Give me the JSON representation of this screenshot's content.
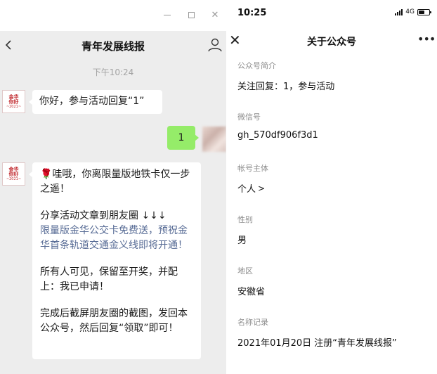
{
  "chat": {
    "title": "青年发展线报",
    "timestamp": "下午10:24",
    "avatar": {
      "line1": "金华",
      "line2": "你好",
      "line3": "~2021~"
    },
    "msg1": "你好，参与活动回复“1”",
    "my_msg": "1",
    "msg2": {
      "flower": "🌹",
      "para1": "哇哦，你离限量版地铁卡仅一步之遥！",
      "para2_line1": "分享活动文章到朋友圈 ↓↓↓",
      "para2_link": "限量版金华公交卡免费送，预祝金华首条轨道交通金义线即将开通！",
      "para3": "所有人可见，保留至开奖，并配上：我已申请！",
      "para4": "完成后截屏朋友圈的截图，发回本公众号，然后回复“领取”即可！"
    }
  },
  "phone": {
    "status": {
      "time": "10:25",
      "network": "4G"
    },
    "nav_title": "关于公众号",
    "fields": {
      "intro": {
        "label": "公众号简介",
        "value": "关注回复：1，参与活动"
      },
      "wechat_id": {
        "label": "微信号",
        "value": "gh_570df906f3d1"
      },
      "owner": {
        "label": "帐号主体",
        "value": "个人"
      },
      "gender": {
        "label": "性别",
        "value": "男"
      },
      "region": {
        "label": "地区",
        "value": "安徽省"
      },
      "name_history": {
        "label": "名称记录",
        "value": "2021年01月20日 注册“青年发展线报”"
      }
    }
  }
}
